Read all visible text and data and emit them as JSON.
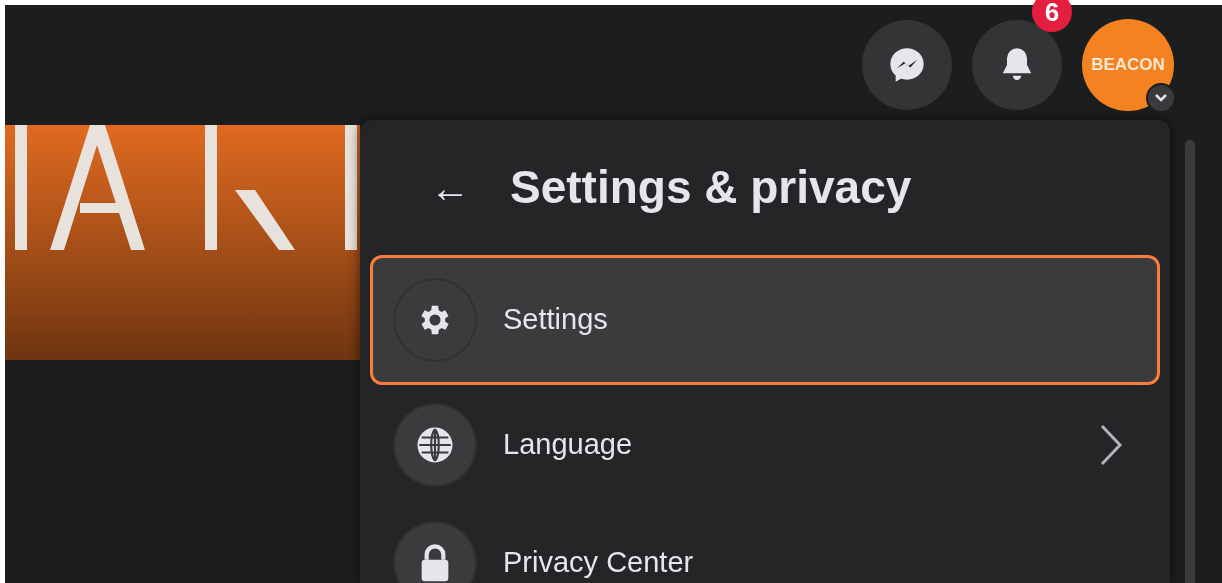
{
  "top_bar": {
    "notification_count": "6",
    "avatar_text": "BEACON"
  },
  "menu": {
    "title": "Settings & privacy",
    "back_icon": "←",
    "items": [
      {
        "label": "Settings",
        "selected": true,
        "has_submenu": false
      },
      {
        "label": "Language",
        "selected": false,
        "has_submenu": true
      },
      {
        "label": "Privacy Center",
        "selected": false,
        "has_submenu": false
      }
    ]
  }
}
